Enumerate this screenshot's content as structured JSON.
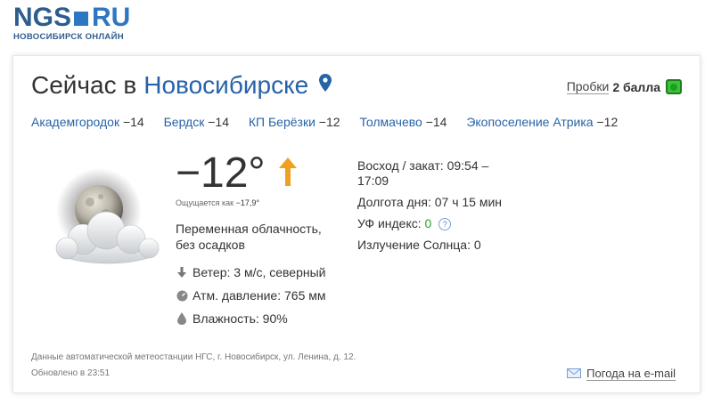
{
  "logo": {
    "brand": "NGS",
    "tld": "RU",
    "subtitle": "НОВОСИБИРСК ОНЛАЙН"
  },
  "header": {
    "title_prefix": "Сейчас в",
    "city": "Новосибирске",
    "traffic_label": "Пробки",
    "traffic_score": "2 балла"
  },
  "nearby": [
    {
      "name": "Академгородок",
      "temp": "−14"
    },
    {
      "name": "Бердск",
      "temp": "−14"
    },
    {
      "name": "КП Берёзки",
      "temp": "−12"
    },
    {
      "name": "Толмачево",
      "temp": "−14"
    },
    {
      "name": "Экопоселение Атрика",
      "temp": "−12"
    }
  ],
  "current": {
    "temperature": "−12°",
    "feels_label": "Ощущается как",
    "feels_value": "−17,9°",
    "description": "Переменная облачность, без осадков",
    "wind": "Ветер: 3 м/с, северный",
    "pressure": "Атм. давление: 765 мм",
    "humidity": "Влажность: 90%"
  },
  "sun": {
    "sunrise_sunset": "Восход / закат: 09:54 – 17:09",
    "day_length": "Долгота дня: 07 ч 15 мин",
    "uv_label": "УФ индекс:",
    "uv_value": "0",
    "radiation": "Излучение Солнца: 0"
  },
  "footer": {
    "source": "Данные автоматической метеостанции НГС, г. Новосибирск, ул. Ленина, д. 12.",
    "updated": "Обновлено в 23:51",
    "email_link": "Погода на e-mail"
  },
  "icons": {
    "pin": "map-pin-icon",
    "traffic": "traffic-light-icon",
    "weather": "moon-cloud-icon",
    "trend": "arrow-up-icon",
    "wind": "arrow-down-icon",
    "pressure": "gauge-icon",
    "humidity": "drop-icon",
    "help": "help-icon",
    "mail": "mail-icon"
  },
  "colors": {
    "link": "#2763a8",
    "trend_arrow": "#f0a020",
    "traffic": "#3ac23a",
    "uv": "#2d9e2d"
  }
}
